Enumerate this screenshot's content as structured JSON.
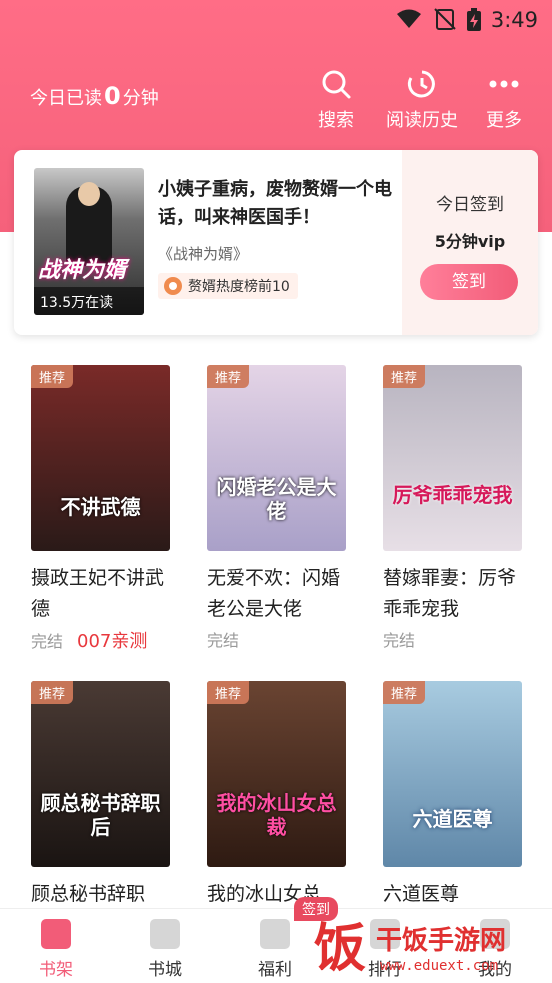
{
  "status_bar": {
    "time": "3:49"
  },
  "header": {
    "read_prefix": "今日已读",
    "read_minutes": "0",
    "read_suffix": "分钟",
    "buttons": [
      {
        "label": "搜索",
        "icon": "search-icon"
      },
      {
        "label": "阅读历史",
        "icon": "history-icon"
      },
      {
        "label": "更多",
        "icon": "more-icon"
      }
    ]
  },
  "featured": {
    "cover_title": "战神为婿",
    "readers": "13.5万在读",
    "headline": "小姨子重病，废物赘婿一个电话，叫来神医国手！",
    "book": "《战神为婿》",
    "rank": "赘婿热度榜前10",
    "sign_label": "今日签到",
    "reward": "5分钟vip",
    "sign_button": "签到"
  },
  "books": [
    {
      "tag": "推荐",
      "name": "摄政王妃不讲武德",
      "cover_text": "不讲武德",
      "status": "完结",
      "extra": "007亲测",
      "bg": "#7a2a28",
      "bg2": "#2a1a18"
    },
    {
      "tag": "推荐",
      "name": "无爱不欢：闪婚老公是大佬",
      "cover_text": "闪婚老公是大佬",
      "status": "完结",
      "extra": "",
      "bg": "#e4d4e6",
      "bg2": "#a9a0c8"
    },
    {
      "tag": "推荐",
      "name": "替嫁罪妻：厉爷乖乖宠我",
      "cover_text": "厉爷乖乖宠我",
      "status": "完结",
      "extra": "",
      "bg": "#b8b4c0",
      "bg2": "#e7dfe6"
    },
    {
      "tag": "推荐",
      "name": "顾总秘书辞职",
      "cover_text": "顾总秘书辞职后",
      "status": "",
      "extra": "",
      "bg": "#4a3a34",
      "bg2": "#1a1412"
    },
    {
      "tag": "推荐",
      "name": "我的冰山女总",
      "cover_text": "我的冰山女总裁",
      "status": "",
      "extra": "",
      "bg": "#6a4432",
      "bg2": "#2e1a12"
    },
    {
      "tag": "推荐",
      "name": "六道医尊",
      "cover_text": "六道医尊",
      "status": "",
      "extra": "",
      "bg": "#a8cbe0",
      "bg2": "#5f87a8"
    }
  ],
  "bottom_nav": [
    {
      "label": "书架",
      "active": true
    },
    {
      "label": "书城",
      "active": false
    },
    {
      "label": "福利",
      "active": false
    },
    {
      "label": "排行",
      "active": false
    },
    {
      "label": "我的",
      "active": false
    }
  ],
  "welfare_badge": "签到",
  "watermark": {
    "char": "饭",
    "site": "干饭手游网",
    "url": "www.eduext.com"
  }
}
